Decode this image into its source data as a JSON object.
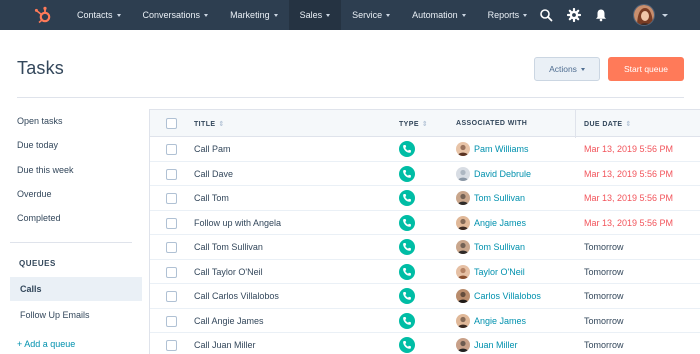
{
  "nav": {
    "items": [
      {
        "label": "Contacts",
        "active": false
      },
      {
        "label": "Conversations",
        "active": false
      },
      {
        "label": "Marketing",
        "active": false
      },
      {
        "label": "Sales",
        "active": true
      },
      {
        "label": "Service",
        "active": false
      },
      {
        "label": "Automation",
        "active": false
      },
      {
        "label": "Reports",
        "active": false
      }
    ],
    "icons": [
      "hubspot-logo-icon",
      "search-icon",
      "gear-icon",
      "bell-icon"
    ]
  },
  "header": {
    "title": "Tasks",
    "actions_label": "Actions",
    "start_queue_label": "Start queue"
  },
  "sidebar": {
    "items": [
      "Open tasks",
      "Due today",
      "Due this week",
      "Overdue",
      "Completed"
    ],
    "queues_heading": "QUEUES",
    "queues": [
      {
        "label": "Calls",
        "active": true
      },
      {
        "label": "Follow Up Emails",
        "active": false
      }
    ],
    "add_queue_label": "+ Add a queue"
  },
  "table": {
    "headers": {
      "title": "TITLE",
      "type": "TYPE",
      "associated": "ASSOCIATED WITH",
      "due": "DUE DATE"
    },
    "rows": [
      {
        "title": "Call Pam",
        "associated": "Pam Williams",
        "due": "Mar 13, 2019 5:56 PM",
        "overdue": true
      },
      {
        "title": "Call Dave",
        "associated": "David Debrule",
        "due": "Mar 13, 2019 5:56 PM",
        "overdue": true
      },
      {
        "title": "Call Tom",
        "associated": "Tom Sullivan",
        "due": "Mar 13, 2019 5:56 PM",
        "overdue": true
      },
      {
        "title": "Follow up with Angela",
        "associated": "Angie James",
        "due": "Mar 13, 2019 5:56 PM",
        "overdue": true
      },
      {
        "title": "Call Tom Sullivan",
        "associated": "Tom Sullivan",
        "due": "Tomorrow",
        "overdue": false
      },
      {
        "title": "Call Taylor O'Neil",
        "associated": "Taylor O'Neil",
        "due": "Tomorrow",
        "overdue": false
      },
      {
        "title": "Call Carlos Villalobos",
        "associated": "Carlos Villalobos",
        "due": "Tomorrow",
        "overdue": false
      },
      {
        "title": "Call Angie James",
        "associated": "Angie James",
        "due": "Tomorrow",
        "overdue": false
      },
      {
        "title": "Call Juan Miller",
        "associated": "Juan Miller",
        "due": "Tomorrow",
        "overdue": false
      }
    ],
    "type_icon": "phone-icon"
  },
  "colors": {
    "nav_bg": "#2d3e50",
    "accent": "#ff7a59",
    "link": "#0091ae",
    "overdue": "#f2545b",
    "call_type": "#00bda5"
  }
}
